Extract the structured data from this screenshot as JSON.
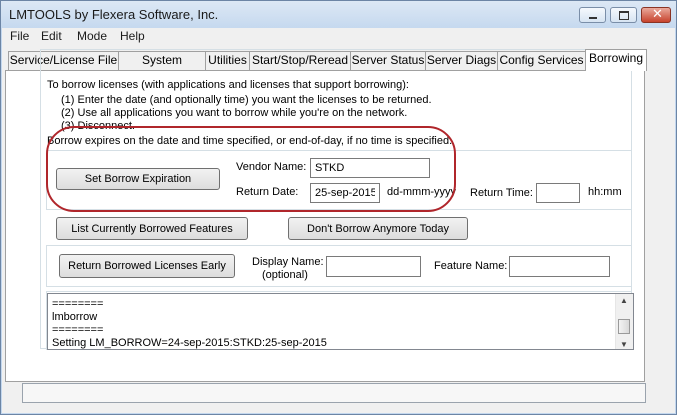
{
  "window": {
    "title": "LMTOOLS by Flexera Software, Inc."
  },
  "menu": [
    "File",
    "Edit",
    "Mode",
    "Help"
  ],
  "tabs": [
    "Service/License File",
    "System Settings",
    "Utilities",
    "Start/Stop/Reread",
    "Server Status",
    "Server Diags",
    "Config Services",
    "Borrowing"
  ],
  "instructions": {
    "intro": "To borrow licenses (with applications and licenses that support borrowing):",
    "step1": "(1) Enter the date (and optionally time) you want the licenses to be returned.",
    "step2": "(2) Use all applications you want to borrow while you're on the network.",
    "step3": "(3) Disconnect.",
    "expiry": "Borrow expires on the date and time specified, or end-of-day, if no time is specified."
  },
  "borrow": {
    "set_button": "Set Borrow Expiration",
    "vendor_label": "Vendor Name:",
    "vendor_value": "STKD",
    "return_date_label": "Return Date:",
    "return_date_value": "25-sep-2015",
    "date_format": "dd-mmm-yyyy",
    "return_time_label": "Return Time:",
    "return_time_value": "",
    "time_format": "hh:mm"
  },
  "actions": {
    "list_button": "List Currently Borrowed Features",
    "dont_borrow_button": "Don't Borrow Anymore Today"
  },
  "return_early": {
    "button": "Return Borrowed Licenses Early",
    "display_name_label": "Display Name:",
    "display_name_note": "(optional)",
    "display_name_value": "",
    "feature_name_label": "Feature Name:",
    "feature_name_value": ""
  },
  "log": [
    "========",
    "lmborrow",
    "========",
    "Setting LM_BORROW=24-sep-2015:STKD:25-sep-2015"
  ],
  "colors": {
    "highlight": "#b0262b"
  }
}
